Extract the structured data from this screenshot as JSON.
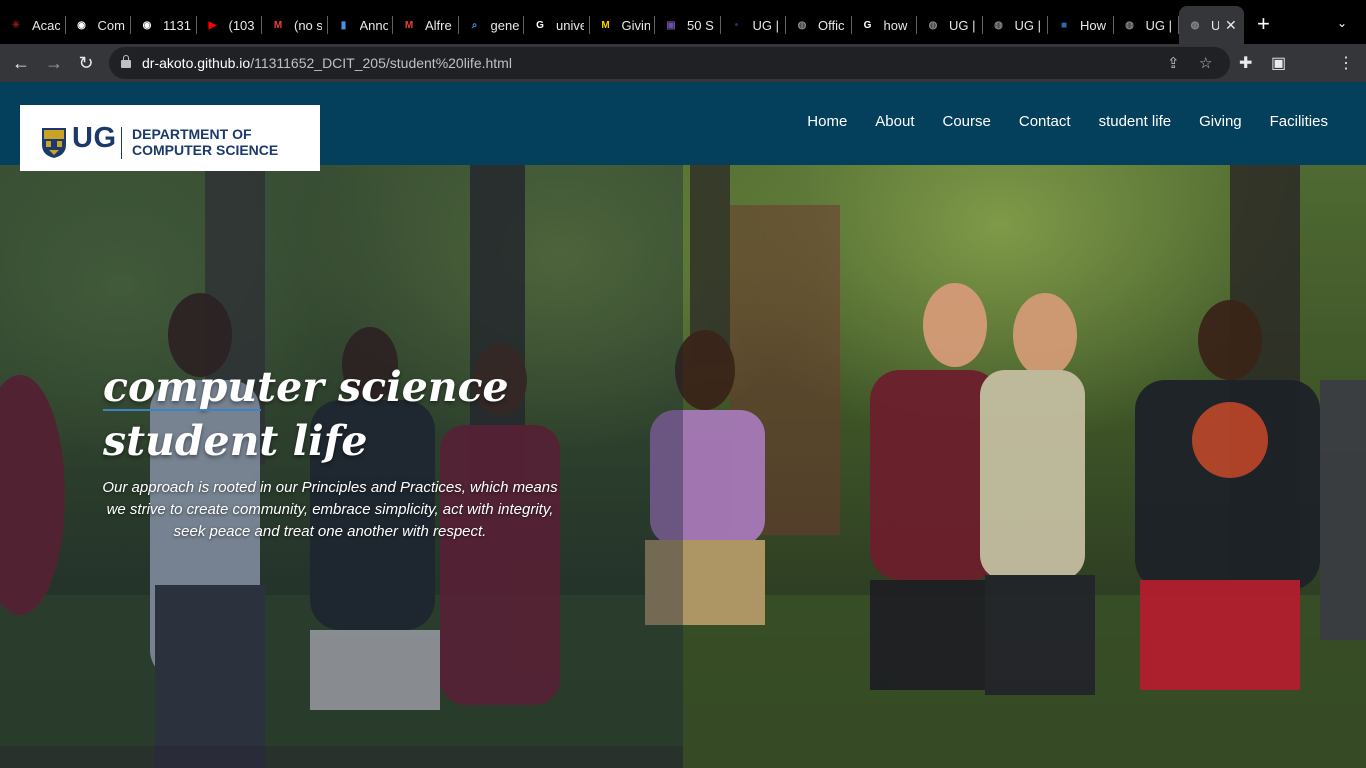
{
  "browser": {
    "tabs": [
      {
        "title": "Acac",
        "favicon": "spider-icon",
        "color": "#8b1a1a"
      },
      {
        "title": "Com",
        "favicon": "github-icon",
        "color": "#ffffff"
      },
      {
        "title": "1131",
        "favicon": "github-icon",
        "color": "#ffffff"
      },
      {
        "title": "(103",
        "favicon": "youtube-icon",
        "color": "#ff0000"
      },
      {
        "title": "(no s",
        "favicon": "gmail-icon",
        "color": "#ea4335"
      },
      {
        "title": "Anno",
        "favicon": "doc-icon",
        "color": "#4a90e2"
      },
      {
        "title": "Alfre",
        "favicon": "gmail-icon",
        "color": "#ea4335"
      },
      {
        "title": "gene",
        "favicon": "search-icon",
        "color": "#4a90e2"
      },
      {
        "title": "unive",
        "favicon": "google-icon",
        "color": "#ffffff"
      },
      {
        "title": "Givin",
        "favicon": "michigan-icon",
        "color": "#ffcb05"
      },
      {
        "title": "50 S",
        "favicon": "purple-square-icon",
        "color": "#6b4fa0"
      },
      {
        "title": "UG |",
        "favicon": "ug-icon",
        "color": "#2c2c7a"
      },
      {
        "title": "Offic",
        "favicon": "globe-icon",
        "color": "#888888"
      },
      {
        "title": "how",
        "favicon": "google-icon",
        "color": "#ffffff"
      },
      {
        "title": "UG |",
        "favicon": "globe-icon",
        "color": "#888888"
      },
      {
        "title": "UG |",
        "favicon": "globe-icon",
        "color": "#888888"
      },
      {
        "title": "How",
        "favicon": "blue-square-icon",
        "color": "#2b6cb0"
      },
      {
        "title": "UG |",
        "favicon": "globe-icon",
        "color": "#888888"
      },
      {
        "title": "U",
        "favicon": "globe-icon",
        "color": "#888888"
      }
    ],
    "active_tab_close": "✕",
    "new_tab_label": "+",
    "tab_menu": "⌄",
    "url_host": "dr-akoto.github.io",
    "url_path": "/11311652_DCIT_205/student%20life.html"
  },
  "site": {
    "logo_ug": "UG",
    "logo_dept_line1": "DEPARTMENT OF",
    "logo_dept_line2": "COMPUTER SCIENCE",
    "nav": [
      "Home",
      "About",
      "Course",
      "Contact",
      "student life",
      "Giving",
      "Facilities"
    ],
    "hero_title_line1": "computer science",
    "hero_title_line2": "student life",
    "hero_text": "Our approach is rooted in our Principles and Practices, which means we strive to create community, embrace simplicity, act with integrity, seek peace and treat one another with respect."
  },
  "colors": {
    "header_bg": "#043f5c",
    "logo_text": "#1b3a6b",
    "accent_underline": "#3d82c4"
  }
}
